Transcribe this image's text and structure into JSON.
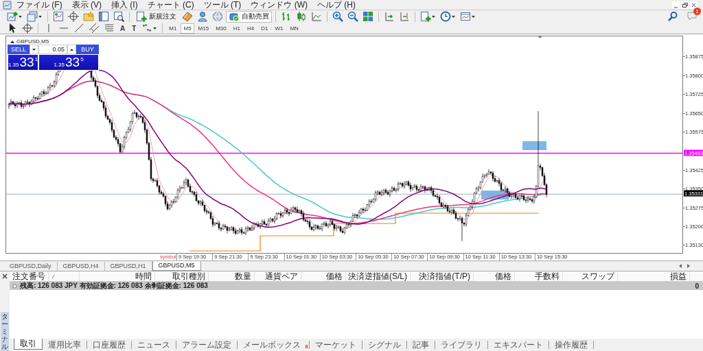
{
  "menu": {
    "items": [
      "ファイル (F)",
      "表示 (V)",
      "挿入 (I)",
      "チャート (C)",
      "ツール (T)",
      "ウィンドウ (W)",
      "ヘルプ (H)"
    ]
  },
  "toolbar": {
    "buttons": [
      {
        "label": "新規注文",
        "selected": false
      },
      {
        "label": "自動売買",
        "selected": true
      }
    ],
    "notification_count": "1"
  },
  "drawing_toolbar": {
    "text_tools": [
      "A",
      "T"
    ],
    "timeframes": [
      {
        "label": "M1",
        "selected": false
      },
      {
        "label": "M5",
        "selected": true
      },
      {
        "label": "M15",
        "selected": false
      },
      {
        "label": "M30",
        "selected": false
      },
      {
        "label": "H1",
        "selected": false
      },
      {
        "label": "H4",
        "selected": false
      },
      {
        "label": "D1",
        "selected": false
      },
      {
        "label": "W1",
        "selected": false
      },
      {
        "label": "MN",
        "selected": false
      }
    ]
  },
  "chart": {
    "title": "GBPUSD,M5",
    "trade_panel": {
      "sell": "SELL",
      "buy": "BUY",
      "lot": "0.05",
      "bid_prefix": "1.35",
      "bid_big": "33",
      "bid_small": "1",
      "ask_prefix": "1.35",
      "ask_big": "33",
      "ask_small": "5"
    },
    "price_labels": [
      "1.35875",
      "1.35800",
      "1.35725",
      "1.35650",
      "1.35575",
      "1.35425",
      "1.35350",
      "1.35275",
      "1.35200",
      "1.35130"
    ],
    "line_label": "1.35493",
    "current_price": "1.35331",
    "symbol_label": "symbol",
    "time_labels": [
      "9 Sep 19:30",
      "9 Sep 21:30",
      "9 Sep 23:30",
      "10 Sep 01:30",
      "10 Sep 03:30",
      "10 Sep 05:30",
      "10 Sep 07:30",
      "10 Sep 09:30",
      "10 Sep 11:30",
      "10 Sep 13:30",
      "10 Sep 15:30"
    ]
  },
  "chart_tabs": [
    {
      "label": "GBPUSD,Daily",
      "selected": false
    },
    {
      "label": "GBPUSD,H4",
      "selected": false
    },
    {
      "label": "GBPUSD,H1",
      "selected": false
    },
    {
      "label": "GBPUSD,M5",
      "selected": true
    }
  ],
  "terminal": {
    "title": "ターミナル",
    "columns": [
      "注文番号",
      "時間",
      "取引種別",
      "数量",
      "通貨ペア",
      "価格",
      "決済逆指値(S/L)",
      "決済指値(T/P)",
      "価格",
      "手数料",
      "スワップ",
      "損益"
    ],
    "summary": "残高: 126 083 JPY  有効証拠金: 126 083  余剰証拠金: 126 083",
    "summary_profit": "0",
    "tabs": [
      {
        "label": "取引",
        "selected": true
      },
      {
        "label": "運用比率",
        "selected": false
      },
      {
        "label": "口座履歴",
        "selected": false
      },
      {
        "label": "ニュース",
        "selected": false
      },
      {
        "label": "アラーム設定",
        "selected": false
      },
      {
        "label": "メールボックス",
        "selected": false,
        "badge": "6"
      },
      {
        "label": "マーケット",
        "selected": false
      },
      {
        "label": "シグナル",
        "selected": false
      },
      {
        "label": "記事",
        "selected": false
      },
      {
        "label": "ライブラリ",
        "selected": false
      },
      {
        "label": "エキスパート",
        "selected": false
      },
      {
        "label": "操作履歴",
        "selected": false
      }
    ]
  }
}
